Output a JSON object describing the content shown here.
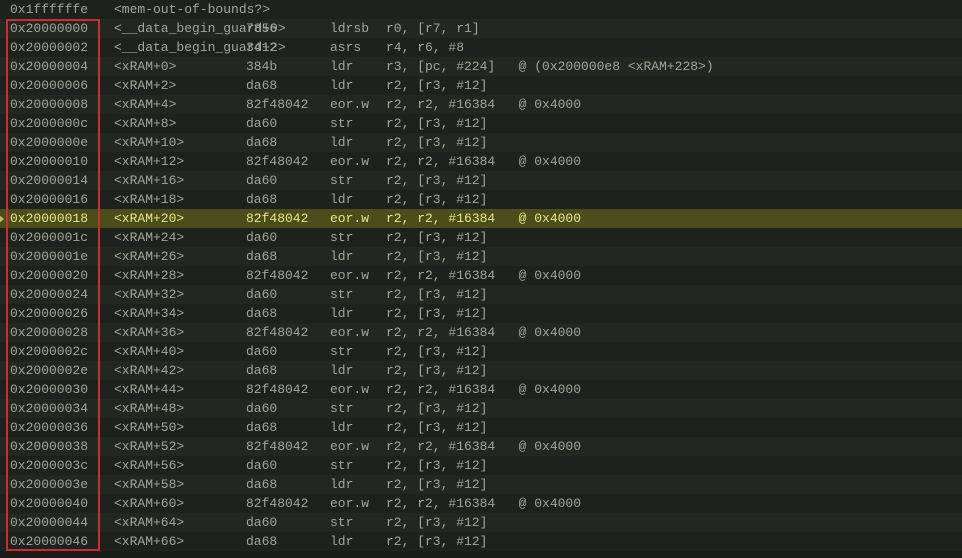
{
  "rows": [
    {
      "addr": "0x1ffffffe",
      "sym": "<mem-out-of-bounds?>",
      "opcode": "",
      "mnem": "",
      "args": "",
      "hl": false,
      "pc": false
    },
    {
      "addr": "0x20000000",
      "sym": "<__data_begin_guard+0>",
      "opcode": "7856",
      "mnem": "ldrsb",
      "args": "r0, [r7, r1]",
      "hl": false,
      "pc": false
    },
    {
      "addr": "0x20000002",
      "sym": "<__data_begin_guard+2>",
      "opcode": "3412",
      "mnem": "asrs",
      "args": "r4, r6, #8",
      "hl": false,
      "pc": false
    },
    {
      "addr": "0x20000004",
      "sym": "<xRAM+0>",
      "opcode": "384b",
      "mnem": "ldr",
      "args": "r3, [pc, #224]   @ (0x200000e8 <xRAM+228>)",
      "hl": false,
      "pc": false
    },
    {
      "addr": "0x20000006",
      "sym": "<xRAM+2>",
      "opcode": "da68",
      "mnem": "ldr",
      "args": "r2, [r3, #12]",
      "hl": false,
      "pc": false
    },
    {
      "addr": "0x20000008",
      "sym": "<xRAM+4>",
      "opcode": "82f48042",
      "mnem": "eor.w",
      "args": "r2, r2, #16384   @ 0x4000",
      "hl": false,
      "pc": false
    },
    {
      "addr": "0x2000000c",
      "sym": "<xRAM+8>",
      "opcode": "da60",
      "mnem": "str",
      "args": "r2, [r3, #12]",
      "hl": false,
      "pc": false
    },
    {
      "addr": "0x2000000e",
      "sym": "<xRAM+10>",
      "opcode": "da68",
      "mnem": "ldr",
      "args": "r2, [r3, #12]",
      "hl": false,
      "pc": false
    },
    {
      "addr": "0x20000010",
      "sym": "<xRAM+12>",
      "opcode": "82f48042",
      "mnem": "eor.w",
      "args": "r2, r2, #16384   @ 0x4000",
      "hl": false,
      "pc": false
    },
    {
      "addr": "0x20000014",
      "sym": "<xRAM+16>",
      "opcode": "da60",
      "mnem": "str",
      "args": "r2, [r3, #12]",
      "hl": false,
      "pc": false
    },
    {
      "addr": "0x20000016",
      "sym": "<xRAM+18>",
      "opcode": "da68",
      "mnem": "ldr",
      "args": "r2, [r3, #12]",
      "hl": false,
      "pc": false
    },
    {
      "addr": "0x20000018",
      "sym": "<xRAM+20>",
      "opcode": "82f48042",
      "mnem": "eor.w",
      "args": "r2, r2, #16384   @ 0x4000",
      "hl": true,
      "pc": true
    },
    {
      "addr": "0x2000001c",
      "sym": "<xRAM+24>",
      "opcode": "da60",
      "mnem": "str",
      "args": "r2, [r3, #12]",
      "hl": false,
      "pc": false
    },
    {
      "addr": "0x2000001e",
      "sym": "<xRAM+26>",
      "opcode": "da68",
      "mnem": "ldr",
      "args": "r2, [r3, #12]",
      "hl": false,
      "pc": false
    },
    {
      "addr": "0x20000020",
      "sym": "<xRAM+28>",
      "opcode": "82f48042",
      "mnem": "eor.w",
      "args": "r2, r2, #16384   @ 0x4000",
      "hl": false,
      "pc": false
    },
    {
      "addr": "0x20000024",
      "sym": "<xRAM+32>",
      "opcode": "da60",
      "mnem": "str",
      "args": "r2, [r3, #12]",
      "hl": false,
      "pc": false
    },
    {
      "addr": "0x20000026",
      "sym": "<xRAM+34>",
      "opcode": "da68",
      "mnem": "ldr",
      "args": "r2, [r3, #12]",
      "hl": false,
      "pc": false
    },
    {
      "addr": "0x20000028",
      "sym": "<xRAM+36>",
      "opcode": "82f48042",
      "mnem": "eor.w",
      "args": "r2, r2, #16384   @ 0x4000",
      "hl": false,
      "pc": false
    },
    {
      "addr": "0x2000002c",
      "sym": "<xRAM+40>",
      "opcode": "da60",
      "mnem": "str",
      "args": "r2, [r3, #12]",
      "hl": false,
      "pc": false
    },
    {
      "addr": "0x2000002e",
      "sym": "<xRAM+42>",
      "opcode": "da68",
      "mnem": "ldr",
      "args": "r2, [r3, #12]",
      "hl": false,
      "pc": false
    },
    {
      "addr": "0x20000030",
      "sym": "<xRAM+44>",
      "opcode": "82f48042",
      "mnem": "eor.w",
      "args": "r2, r2, #16384   @ 0x4000",
      "hl": false,
      "pc": false
    },
    {
      "addr": "0x20000034",
      "sym": "<xRAM+48>",
      "opcode": "da60",
      "mnem": "str",
      "args": "r2, [r3, #12]",
      "hl": false,
      "pc": false
    },
    {
      "addr": "0x20000036",
      "sym": "<xRAM+50>",
      "opcode": "da68",
      "mnem": "ldr",
      "args": "r2, [r3, #12]",
      "hl": false,
      "pc": false
    },
    {
      "addr": "0x20000038",
      "sym": "<xRAM+52>",
      "opcode": "82f48042",
      "mnem": "eor.w",
      "args": "r2, r2, #16384   @ 0x4000",
      "hl": false,
      "pc": false
    },
    {
      "addr": "0x2000003c",
      "sym": "<xRAM+56>",
      "opcode": "da60",
      "mnem": "str",
      "args": "r2, [r3, #12]",
      "hl": false,
      "pc": false
    },
    {
      "addr": "0x2000003e",
      "sym": "<xRAM+58>",
      "opcode": "da68",
      "mnem": "ldr",
      "args": "r2, [r3, #12]",
      "hl": false,
      "pc": false
    },
    {
      "addr": "0x20000040",
      "sym": "<xRAM+60>",
      "opcode": "82f48042",
      "mnem": "eor.w",
      "args": "r2, r2, #16384   @ 0x4000",
      "hl": false,
      "pc": false
    },
    {
      "addr": "0x20000044",
      "sym": "<xRAM+64>",
      "opcode": "da60",
      "mnem": "str",
      "args": "r2, [r3, #12]",
      "hl": false,
      "pc": false
    },
    {
      "addr": "0x20000046",
      "sym": "<xRAM+66>",
      "opcode": "da68",
      "mnem": "ldr",
      "args": "r2, [r3, #12]",
      "hl": false,
      "pc": false
    }
  ]
}
